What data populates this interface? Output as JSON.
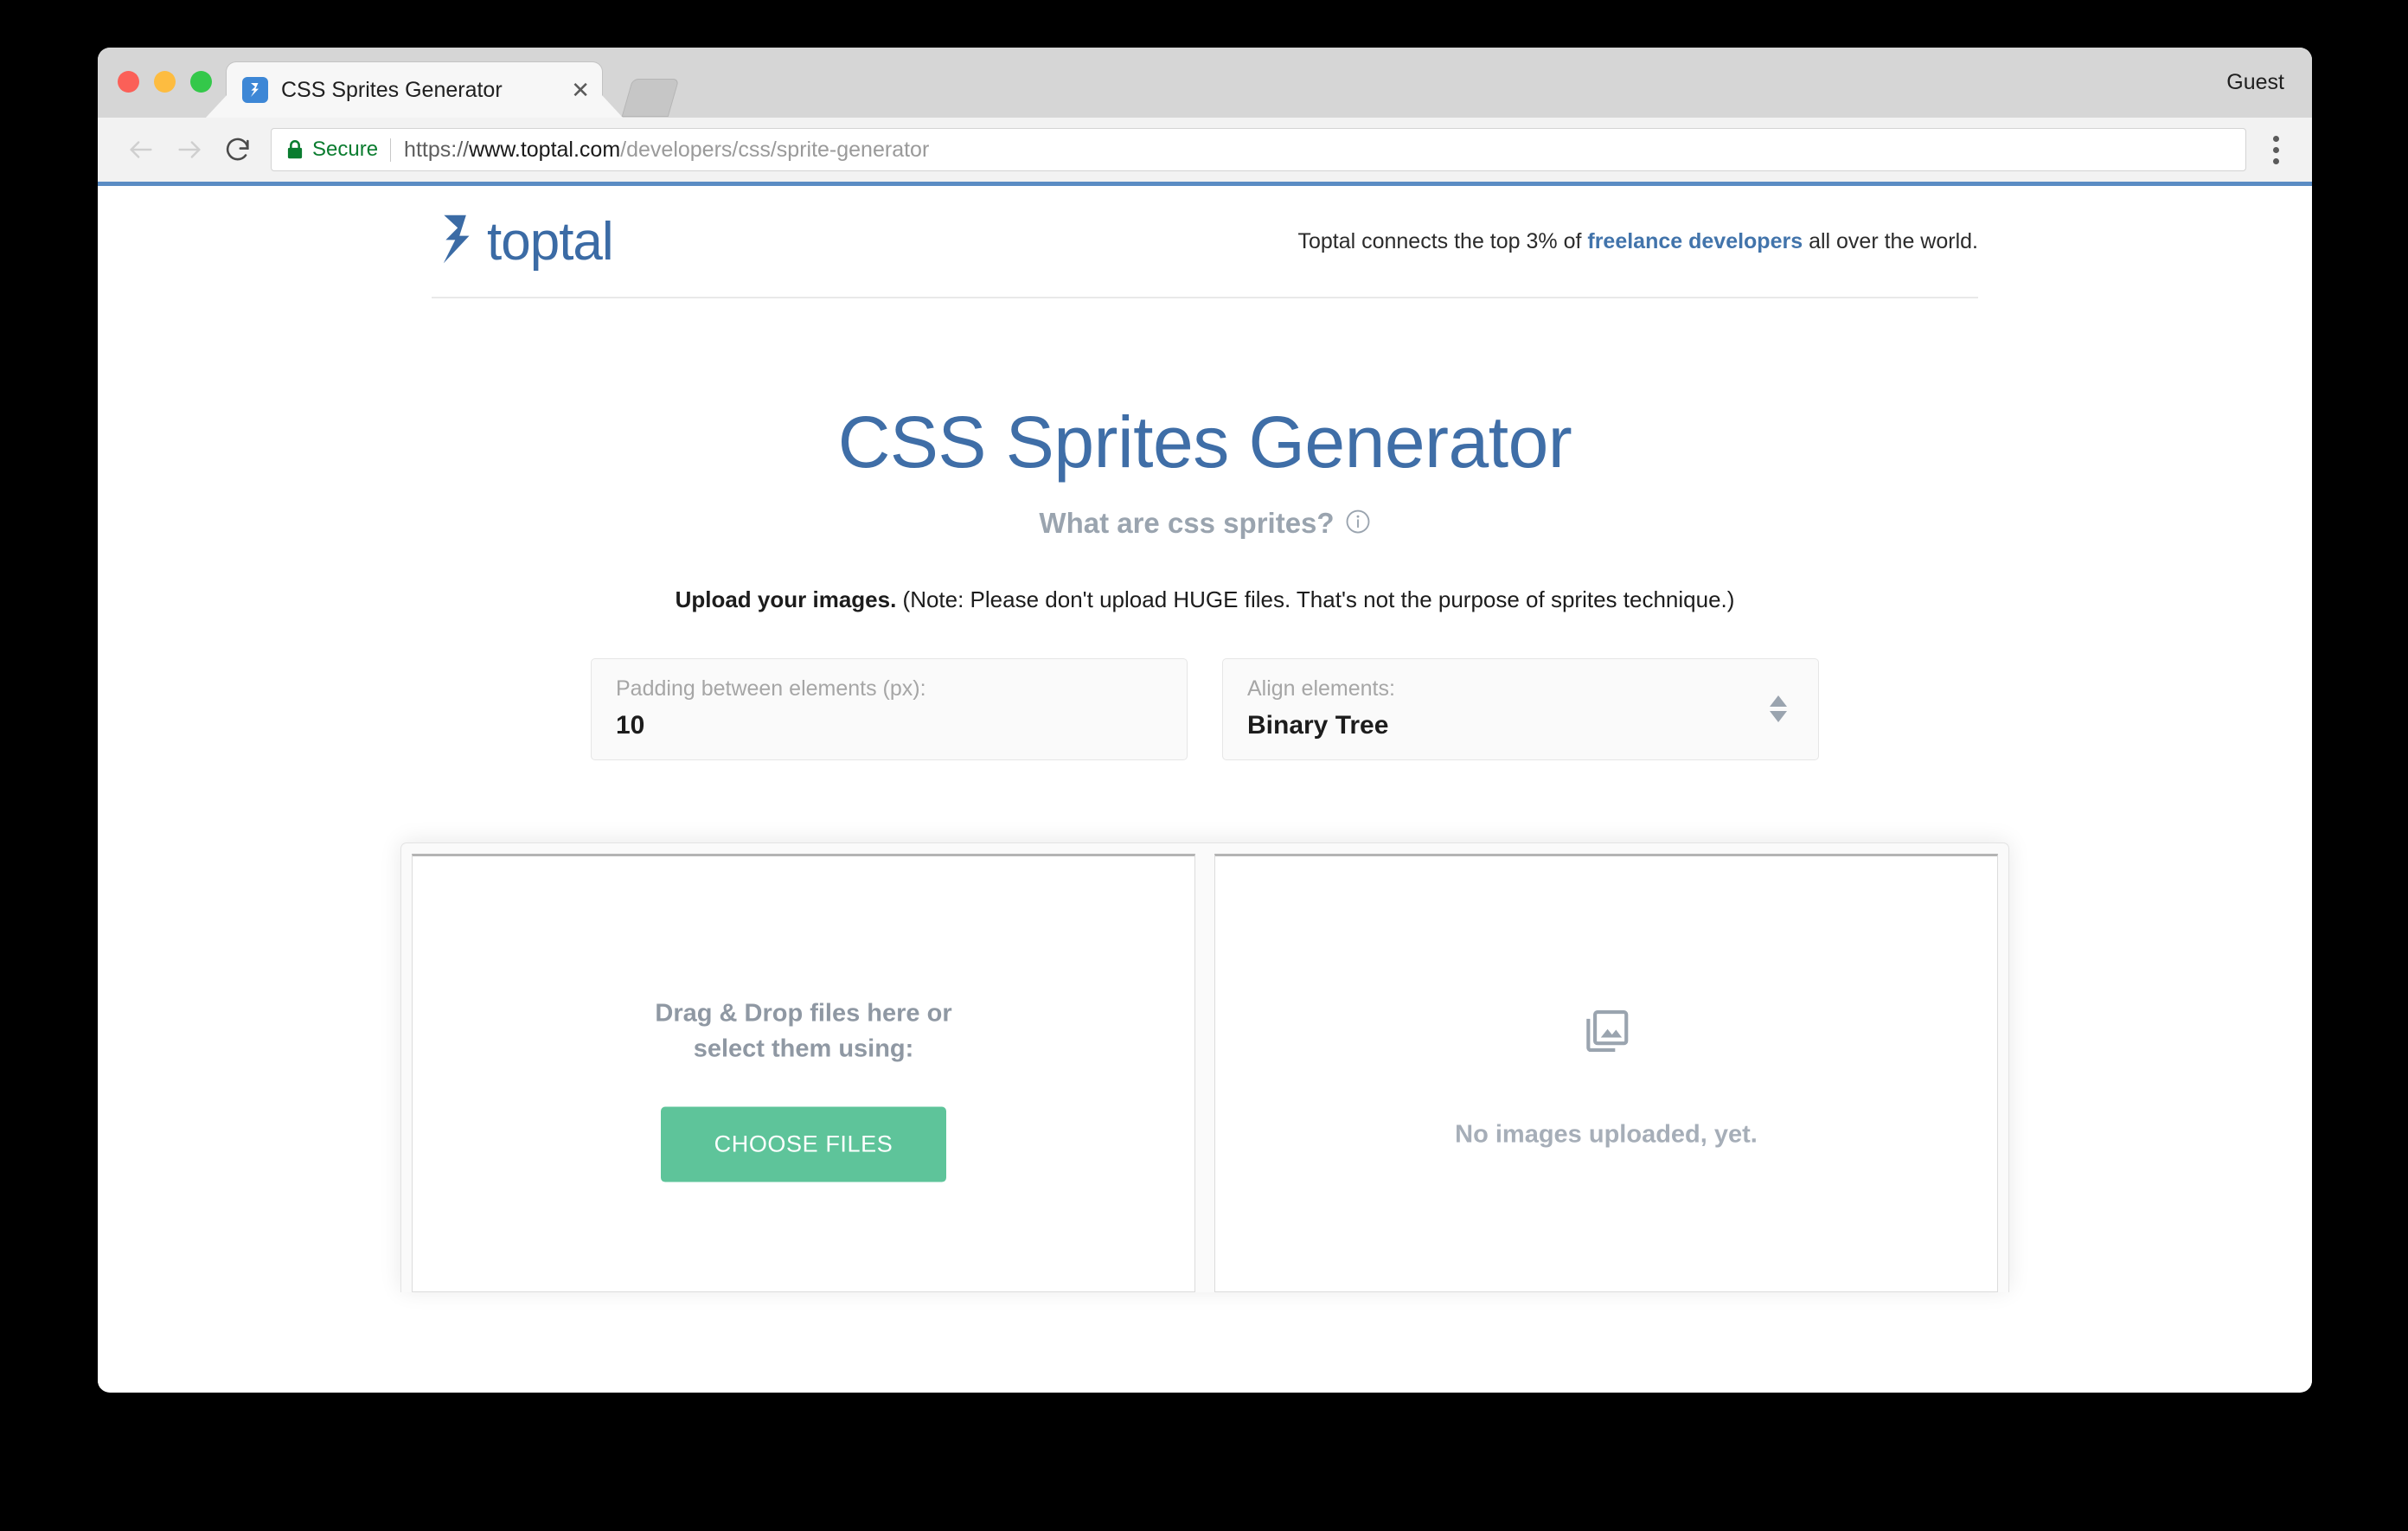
{
  "browser": {
    "guest_label": "Guest",
    "tab": {
      "title": "CSS Sprites Generator",
      "favicon": "toptal-favicon-icon",
      "close": "✕"
    },
    "nav": {
      "back": "back-icon",
      "forward": "forward-icon",
      "reload": "reload-icon",
      "menu": "overflow-menu-icon"
    },
    "address": {
      "lock": "lock-icon",
      "secure_label": "Secure",
      "url_scheme": "https://",
      "url_host": "www.toptal.com",
      "url_path": "/developers/css/sprite-generator",
      "url_full": "https://www.toptal.com/developers/css/sprite-generator"
    },
    "colors": {
      "progress_line": "#5b8cc4",
      "secure_green": "#0a7c2f"
    }
  },
  "site_header": {
    "logo_text": "toptal",
    "tagline_before": "Toptal connects the top 3% of ",
    "tagline_link": "freelance developers",
    "tagline_after": " all over the world."
  },
  "hero": {
    "title": "CSS Sprites Generator",
    "subtitle": "What are css sprites?",
    "info_icon": "info-circle-icon",
    "upload_note_bold": "Upload your images.",
    "upload_note_rest": " (Note: Please don't upload HUGE files. That's not the purpose of sprites technique.)"
  },
  "options": {
    "padding": {
      "label": "Padding between elements (px):",
      "value": "10"
    },
    "align": {
      "label": "Align elements:",
      "value": "Binary Tree",
      "stepper_icon": "stepper-arrows-icon"
    }
  },
  "dropzone": {
    "text_line1": "Drag & Drop files here or",
    "text_line2": "select them using:",
    "button_label": "CHOOSE FILES",
    "button_color": "#5ec49a"
  },
  "preview": {
    "placeholder_icon": "image-library-icon",
    "empty_text": "No images uploaded, yet."
  }
}
